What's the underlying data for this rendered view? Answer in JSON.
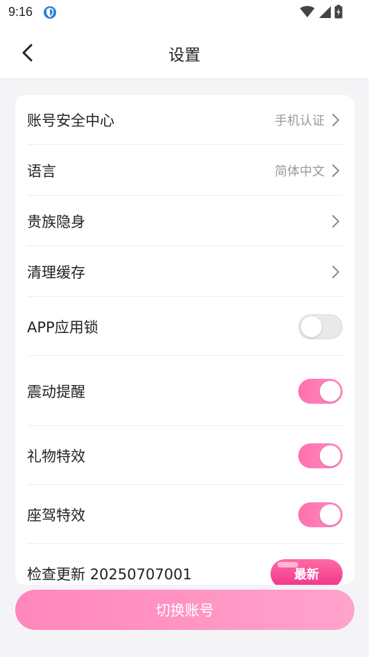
{
  "status_bar": {
    "time": "9:16",
    "app_icon": "shield-icon",
    "icons": [
      "wifi-icon",
      "signal-icon",
      "battery-icon"
    ]
  },
  "header": {
    "title": "设置",
    "back_icon": "chevron-left-icon"
  },
  "settings": {
    "account_security": {
      "label": "账号安全中心",
      "value": "手机认证"
    },
    "language": {
      "label": "语言",
      "value": "简体中文"
    },
    "noble_stealth": {
      "label": "贵族隐身"
    },
    "clear_cache": {
      "label": "清理缓存"
    },
    "app_lock": {
      "label": "APP应用锁",
      "on": false
    },
    "vibration": {
      "label": "震动提醒",
      "on": true
    },
    "gift_effects": {
      "label": "礼物特效",
      "on": true
    },
    "mount_effects": {
      "label": "座驾特效",
      "on": true
    },
    "check_update": {
      "label": "检查更新 20250707001",
      "badge": "最新"
    }
  },
  "footer": {
    "switch_account": "切换账号"
  },
  "colors": {
    "accent": "#ff6fae",
    "background": "#f4f4f6"
  }
}
